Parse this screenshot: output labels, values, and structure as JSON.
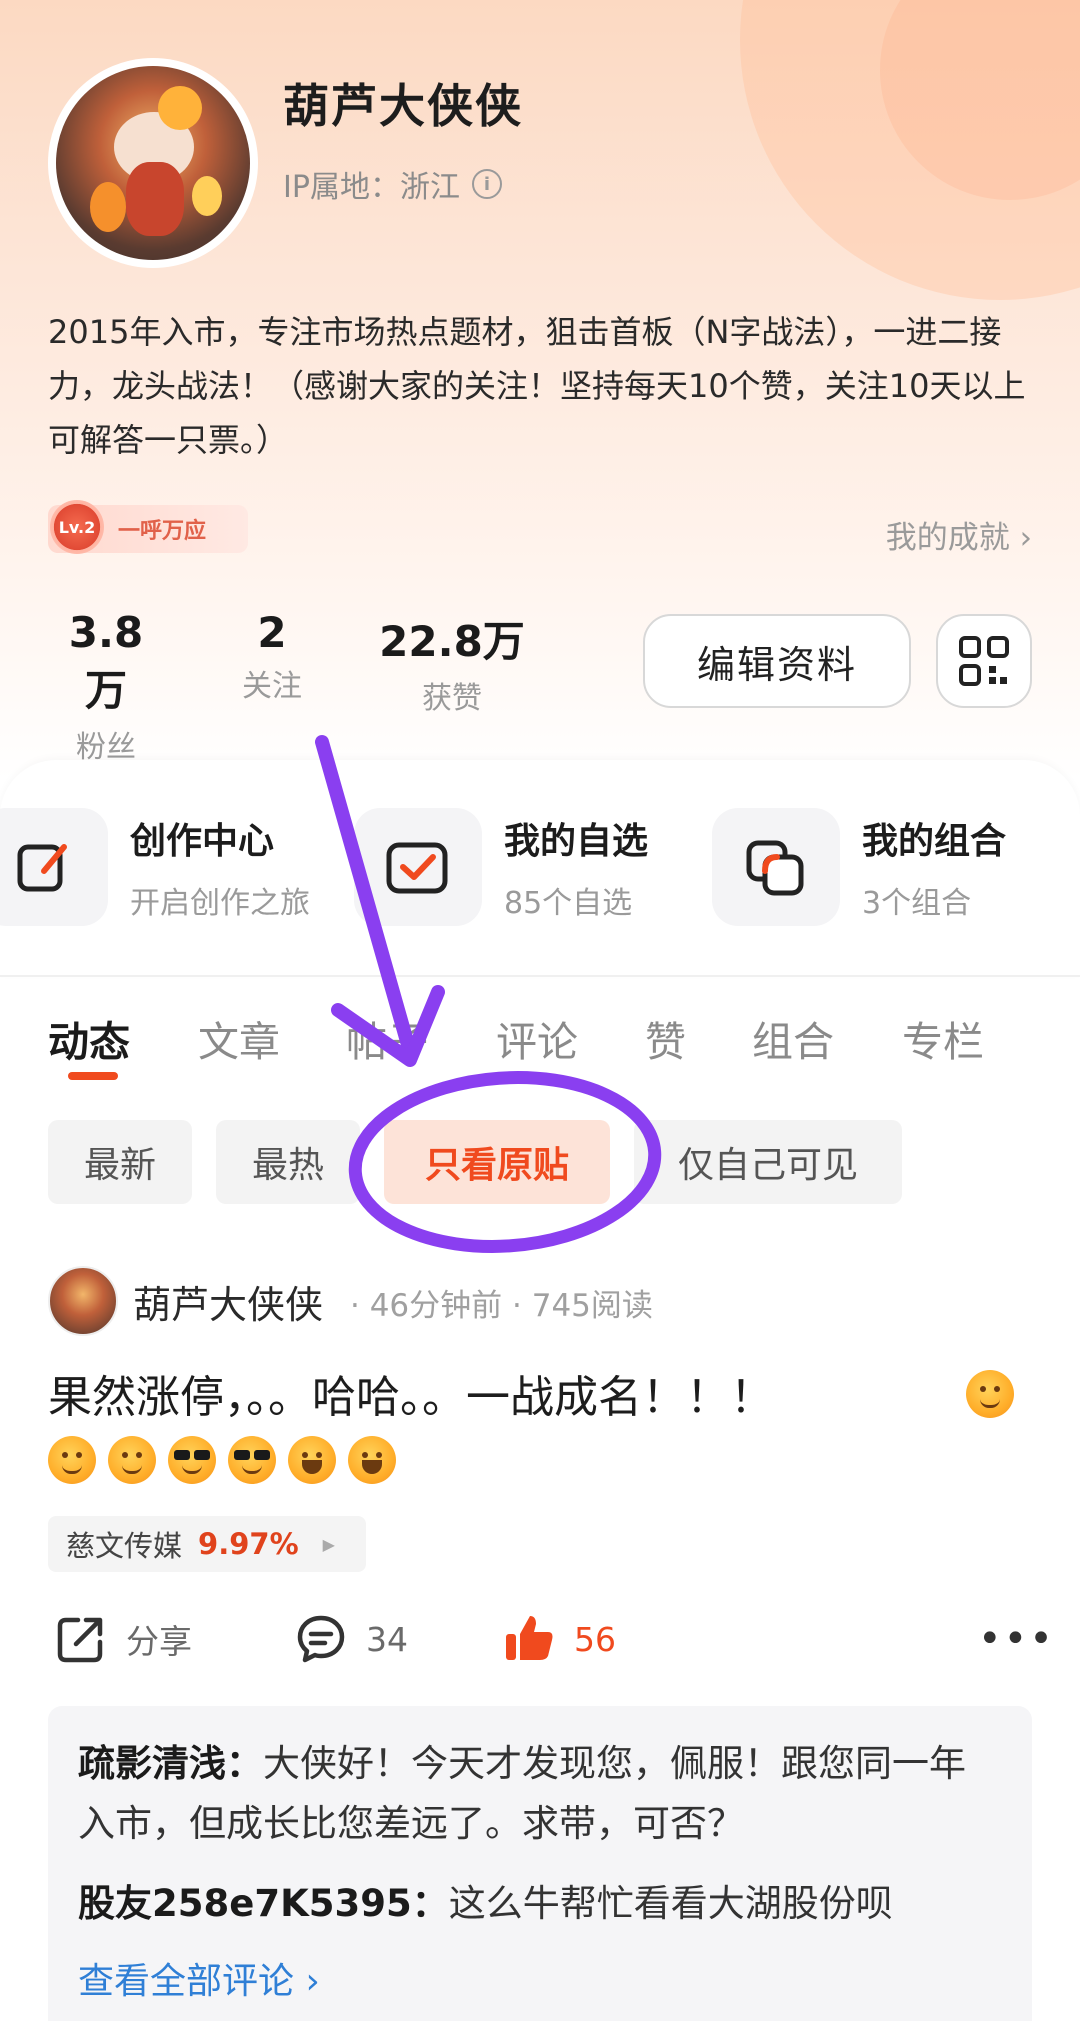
{
  "profile": {
    "username": "葫芦大侠侠",
    "ip_location": "IP属地：浙江",
    "bio": "2015年入市，专注市场热点题材，狙击首板（N字战法），一进二接力，龙头战法！（感谢大家的关注！坚持每天10个赞，关注10天以上可解答一只票。）",
    "badge_level": "Lv.2",
    "badge_label": "一呼万应",
    "achievements_link": "我的成就 ›"
  },
  "stats": [
    {
      "value": "3.8万",
      "label": "粉丝"
    },
    {
      "value": "2",
      "label": "关注"
    },
    {
      "value": "22.8万",
      "label": "获赞"
    }
  ],
  "buttons": {
    "edit_profile": "编辑资料"
  },
  "shortcuts": [
    {
      "title": "创作中心",
      "subtitle": "开启创作之旅",
      "icon": "edit-icon"
    },
    {
      "title": "我的自选",
      "subtitle": "85个自选",
      "icon": "checkbox-icon"
    },
    {
      "title": "我的组合",
      "subtitle": "3个组合",
      "icon": "portfolio-icon"
    }
  ],
  "tabs": [
    "动态",
    "文章",
    "帖子",
    "评论",
    "赞",
    "组合",
    "专栏"
  ],
  "active_tab": "动态",
  "filters": [
    "最新",
    "最热",
    "只看原贴",
    "仅自己可见"
  ],
  "active_filter": "只看原贴",
  "post": {
    "author": "葫芦大侠侠",
    "meta": "· 46分钟前 · 745阅读",
    "text": "果然涨停，。。哈哈。。一战成名！！！",
    "stock_name": "慈文传媒",
    "stock_change": "9.97%",
    "share_label": "分享",
    "comment_count": "34",
    "like_count": "56"
  },
  "comments": [
    {
      "user": "疏影清浅：",
      "text": "大侠好！今天才发现您，佩服！跟您同一年入市，但成长比您差远了。求带，可否？"
    },
    {
      "user": "股友258e7K5395：",
      "text": "这么牛帮忙看看大湖股份呗"
    }
  ],
  "view_all_comments": "查看全部评论 ›",
  "colors": {
    "accent": "#f04a1e",
    "annotation": "#8a3ff0",
    "link": "#2f7fd6"
  }
}
